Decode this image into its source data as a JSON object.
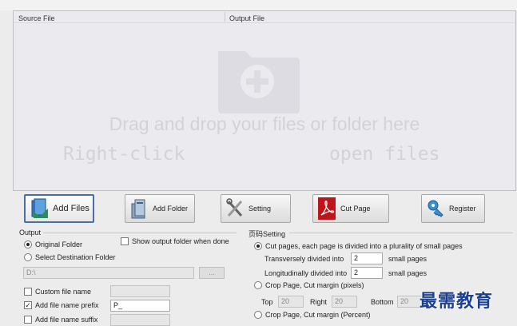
{
  "file_list": {
    "col_source": "Source File",
    "col_output": "Output File",
    "drop_line1": "Drag and drop your files or folder here",
    "drop_line2_left": "Right-click",
    "drop_line2_right": "open files"
  },
  "toolbar": {
    "add_files": "Add Files",
    "add_folder": "Add Folder",
    "setting": "Setting",
    "cut_page": "Cut Page",
    "register": "Register"
  },
  "output": {
    "title": "Output",
    "original_folder": "Original Folder",
    "show_output_folder": "Show output folder when done",
    "select_destination": "Select Destination Folder",
    "path_value": "D:\\",
    "browse_label": "...",
    "custom_file_name": "Custom file name",
    "add_prefix": "Add file name prefix",
    "prefix_value": "P_",
    "add_suffix": "Add file name suffix"
  },
  "page_setting": {
    "title": "页码Setting",
    "cut_pages": "Cut pages, each page is divided into a plurality of small pages",
    "trans_label": "Transversely divided into",
    "trans_value": "2",
    "trans_unit": "small pages",
    "long_label": "Longitudinally divided into",
    "long_value": "2",
    "long_unit": "small pages",
    "crop_pixels": "Crop Page, Cut margin (pixels)",
    "top_label": "Top",
    "top_value": "20",
    "right_label": "Right",
    "right_value": "20",
    "bottom_label": "Bottom",
    "bottom_value": "20",
    "crop_percent": "Crop Page, Cut margin (Percent)"
  },
  "watermark": "最需教育",
  "colors": {
    "accent": "#4a6fa5",
    "pdf_red": "#c0141b",
    "watermark": "#1d3f8f"
  }
}
